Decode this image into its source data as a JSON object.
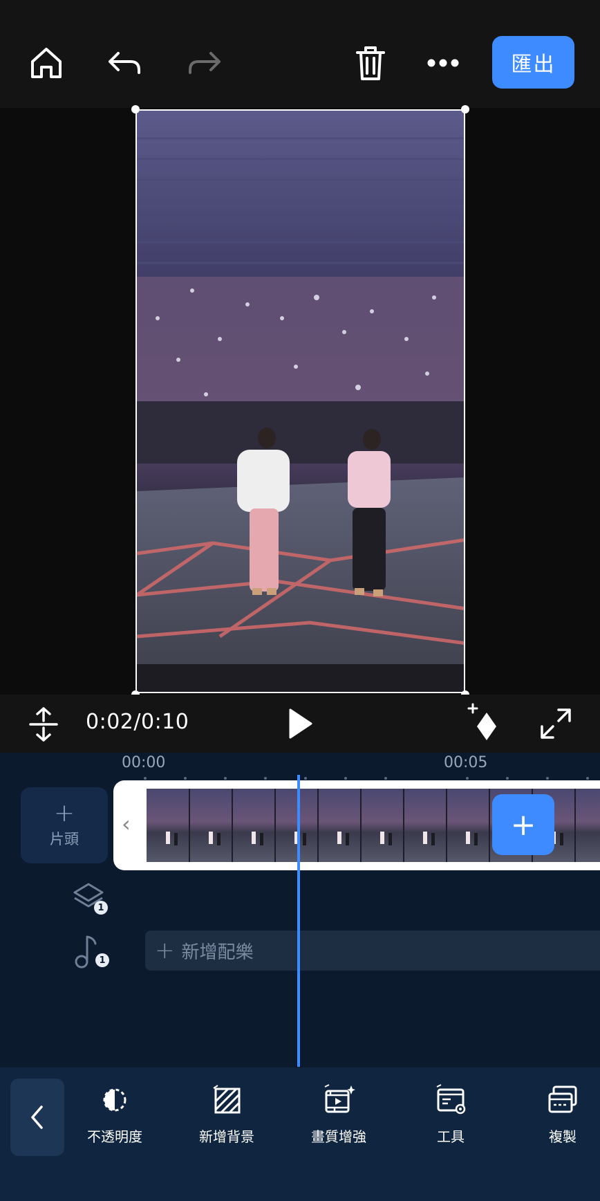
{
  "top_bar": {
    "export_label": "匯出"
  },
  "player": {
    "timecode": "0:02/0:10"
  },
  "timeline": {
    "ruler_labels": [
      "00:00",
      "00:05"
    ],
    "intro_label": "片頭",
    "overlay_count": "1",
    "audio_count": "1",
    "add_music_label": "新增配樂"
  },
  "toolbar": {
    "tools": [
      {
        "label": "不透明度",
        "icon": "opacity-icon"
      },
      {
        "label": "新增背景",
        "icon": "background-icon"
      },
      {
        "label": "畫質增強",
        "icon": "enhance-icon"
      },
      {
        "label": "工具",
        "icon": "tools-icon"
      },
      {
        "label": "複製",
        "icon": "duplicate-icon"
      }
    ]
  },
  "colors": {
    "accent": "#3d8bff",
    "timeline_bg": "#0c1a2e",
    "toolbar_bg": "#102640"
  }
}
